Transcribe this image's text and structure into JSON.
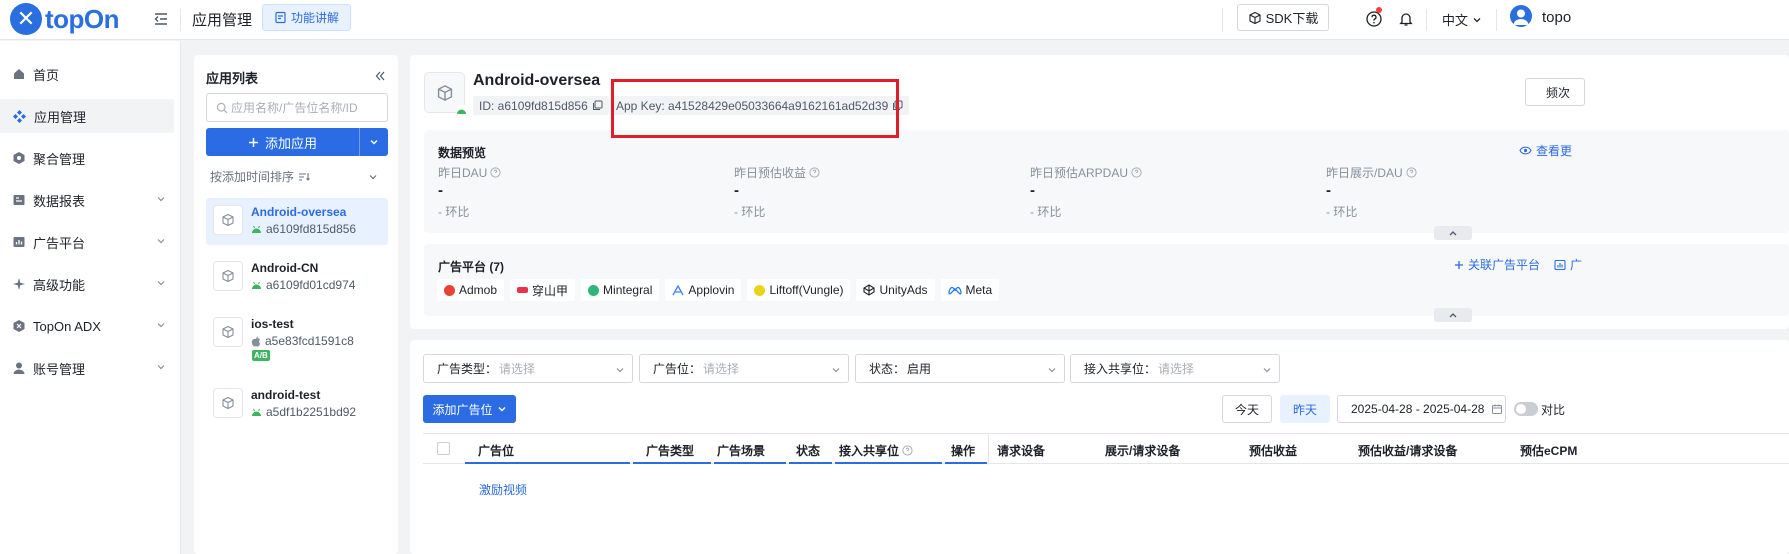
{
  "brand": {
    "name": "topOn",
    "color": "#2a6fe0"
  },
  "header": {
    "page_title": "应用管理",
    "feature_button": "功能讲解",
    "sdk_button": "SDK下载",
    "language": "中文",
    "username": "topo"
  },
  "nav": {
    "items": [
      {
        "label": "首页",
        "icon": "home-icon"
      },
      {
        "label": "应用管理",
        "icon": "diamond-grid-icon",
        "active": true
      },
      {
        "label": "聚合管理",
        "icon": "hexagon-icon"
      },
      {
        "label": "数据报表",
        "icon": "report-icon"
      },
      {
        "label": "广告平台",
        "icon": "chart-board-icon"
      },
      {
        "label": "高级功能",
        "icon": "sparkle-icon"
      },
      {
        "label": "TopOn ADX",
        "icon": "adx-icon"
      },
      {
        "label": "账号管理",
        "icon": "user-icon"
      }
    ]
  },
  "app_list": {
    "title": "应用列表",
    "search_placeholder": "应用名称/广告位名称/ID",
    "add_button": "添加应用",
    "sort_label": "按添加时间排序",
    "apps": [
      {
        "name": "Android-oversea",
        "id": "a6109fd815d856",
        "platform": "android",
        "active": true
      },
      {
        "name": "Android-CN",
        "id": "a6109fd01cd974",
        "platform": "android"
      },
      {
        "name": "ios-test",
        "id": "a5e83fcd1591c8",
        "platform": "ios",
        "badge": "A/B"
      },
      {
        "name": "android-test",
        "id": "a5df1b2251bd92",
        "platform": "android"
      }
    ]
  },
  "detail": {
    "app_name": "Android-oversea",
    "id_text": "ID: a6109fd815d856",
    "app_key_text": "App Key: a41528429e05033664a9162161ad52d39",
    "freq_button": "频次",
    "preview": {
      "title": "数据预览",
      "link": "查看更",
      "metrics": [
        {
          "label": "昨日DAU",
          "value": "-",
          "comparison": "- 环比"
        },
        {
          "label": "昨日预估收益",
          "value": "-",
          "comparison": "- 环比"
        },
        {
          "label": "昨日预估ARPDAU",
          "value": "-",
          "comparison": "- 环比"
        },
        {
          "label": "昨日展示/DAU",
          "value": "-",
          "comparison": "- 环比"
        }
      ]
    },
    "platforms": {
      "title": "广告平台 (7)",
      "link_associate": "关联广告平台",
      "link_more": "广",
      "items": [
        {
          "name": "Admob",
          "color": "#ea4335"
        },
        {
          "name": "穿山甲",
          "color": "#e8334a"
        },
        {
          "name": "Mintegral",
          "color": "#2fb67a"
        },
        {
          "name": "Applovin",
          "color": "#3b82f6"
        },
        {
          "name": "Liftoff(Vungle)",
          "color": "#e8d21a"
        },
        {
          "name": "UnityAds",
          "color": "#1d2129"
        },
        {
          "name": "Meta",
          "color": "#1877f2"
        }
      ]
    }
  },
  "filters": [
    {
      "label": "广告类型：",
      "placeholder": "请选择"
    },
    {
      "label": "广告位：",
      "placeholder": "请选择"
    },
    {
      "label": "状态：",
      "value": "启用"
    },
    {
      "label": "接入共享位：",
      "placeholder": "请选择"
    }
  ],
  "toolbar": {
    "add_placement": "添加广告位",
    "today": "今天",
    "yesterday": "昨天",
    "date_range": "2025-04-28 - 2025-04-28",
    "compare": "对比"
  },
  "table": {
    "columns_left": [
      "广告位",
      "广告类型",
      "广告场景",
      "状态",
      "接入共享位",
      "操作"
    ],
    "columns_right": [
      "请求设备",
      "展示/请求设备",
      "预估收益",
      "预估收益/请求设备",
      "预估eCPM"
    ],
    "first_row_link": "激励视频"
  }
}
